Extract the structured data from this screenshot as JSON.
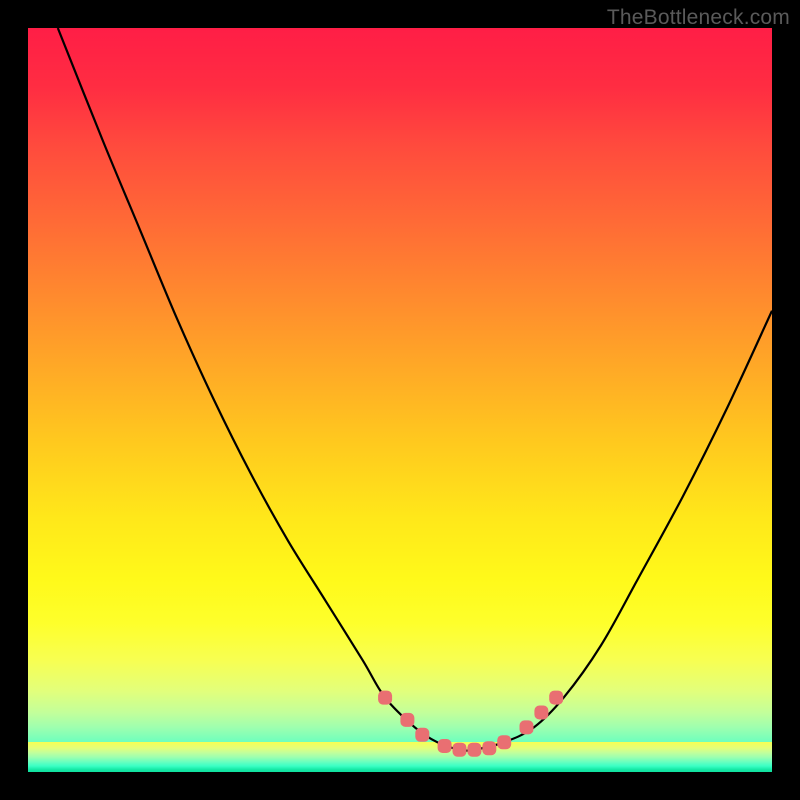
{
  "watermark": "TheBottleneck.com",
  "colors": {
    "background": "#000000",
    "curve_stroke": "#000000",
    "marker_fill": "#e96f72",
    "gradient_top": "#ff1e46",
    "gradient_mid": "#ffe81a",
    "gradient_bottom": "#12df9e"
  },
  "chart_data": {
    "type": "line",
    "title": "",
    "xlabel": "",
    "ylabel": "",
    "xlim": [
      0,
      100
    ],
    "ylim": [
      0,
      100
    ],
    "grid": false,
    "legend": null,
    "series": [
      {
        "name": "bottleneck-curve",
        "x": [
          4,
          10,
          15,
          20,
          25,
          30,
          35,
          40,
          45,
          48,
          52,
          55,
          58,
          60,
          64,
          68,
          72,
          77,
          82,
          88,
          94,
          100
        ],
        "y": [
          100,
          85,
          73,
          61,
          50,
          40,
          31,
          23,
          15,
          10,
          6,
          4,
          3,
          3,
          4,
          6,
          10,
          17,
          26,
          37,
          49,
          62
        ]
      }
    ],
    "markers": {
      "name": "highlight-dots",
      "color": "#e96f72",
      "points": [
        {
          "x": 48,
          "y": 10
        },
        {
          "x": 51,
          "y": 7
        },
        {
          "x": 53,
          "y": 5
        },
        {
          "x": 56,
          "y": 3.5
        },
        {
          "x": 58,
          "y": 3
        },
        {
          "x": 60,
          "y": 3
        },
        {
          "x": 62,
          "y": 3.2
        },
        {
          "x": 64,
          "y": 4
        },
        {
          "x": 67,
          "y": 6
        },
        {
          "x": 69,
          "y": 8
        },
        {
          "x": 71,
          "y": 10
        }
      ]
    }
  }
}
